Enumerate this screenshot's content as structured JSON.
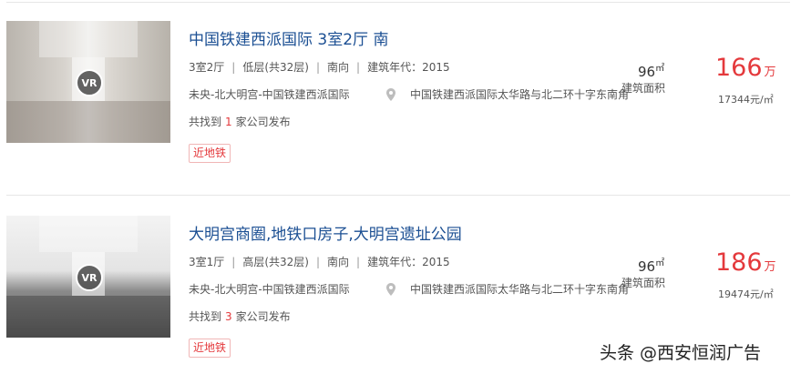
{
  "listings": [
    {
      "vr_label": "VR",
      "title": "中国铁建西派国际 3室2厅 南",
      "layout": "3室2厅",
      "floor": "低层(共32层)",
      "orientation": "南向",
      "year": "建筑年代：2015",
      "community": "未央-北大明宫-中国铁建西派国际",
      "address": "中国铁建西派国际太华路与北二环十字东南角",
      "found_prefix": "共找到",
      "found_count": "1",
      "found_suffix": "家公司发布",
      "tag": "近地铁",
      "area": "96",
      "area_unit": "㎡",
      "area_label": "建筑面积",
      "price": "166",
      "price_unit": "万",
      "unit_price": "17344元/㎡"
    },
    {
      "vr_label": "VR",
      "title": "大明宫商圈,地铁口房子,大明宫遗址公园",
      "layout": "3室1厅",
      "floor": "高层(共32层)",
      "orientation": "南向",
      "year": "建筑年代：2015",
      "community": "未央-北大明宫-中国铁建西派国际",
      "address": "中国铁建西派国际太华路与北二环十字东南角",
      "found_prefix": "共找到",
      "found_count": "3",
      "found_suffix": "家公司发布",
      "tag": "近地铁",
      "area": "96",
      "area_unit": "㎡",
      "area_label": "建筑面积",
      "price": "186",
      "price_unit": "万",
      "unit_price": "19474元/㎡"
    }
  ],
  "watermark": "头条 @西安恒润广告",
  "colors": {
    "title": "#1b4f93",
    "price": "#e4393c",
    "tag_border": "#f1b6b6"
  },
  "icons": [
    "location-pin-icon",
    "vr-icon"
  ]
}
